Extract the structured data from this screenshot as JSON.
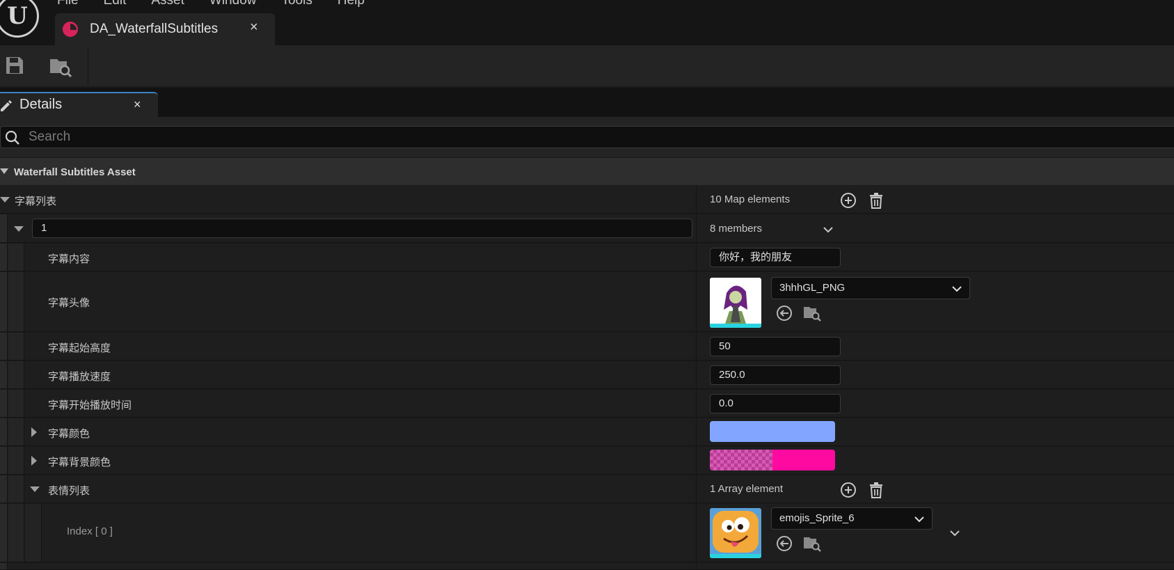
{
  "menu": [
    "File",
    "Edit",
    "Asset",
    "Window",
    "Tools",
    "Help"
  ],
  "document_tab": {
    "title": "DA_WaterfallSubtitles",
    "close": "×"
  },
  "details_tab": {
    "label": "Details",
    "close": "×"
  },
  "search": {
    "placeholder": "Search"
  },
  "category": {
    "label": "Waterfall Subtitles Asset"
  },
  "subtitle_list": {
    "label": "字幕列表",
    "count": "10 Map elements",
    "entry": {
      "key": "1",
      "members": "8 members",
      "content": {
        "label": "字幕内容",
        "value": "你好，我的朋友"
      },
      "avatar": {
        "label": "字幕头像",
        "asset": "3hhhGL_PNG"
      },
      "start_height": {
        "label": "字幕起始高度",
        "value": "50"
      },
      "play_speed": {
        "label": "字幕播放速度",
        "value": "250.0"
      },
      "start_time": {
        "label": "字幕开始播放时间",
        "value": "0.0"
      },
      "color": {
        "label": "字幕颜色",
        "hex": "#82a6ff"
      },
      "bg_color": {
        "label": "字幕背景颜色",
        "hex": "#ff0aa0"
      },
      "emoji_list": {
        "label": "表情列表",
        "count": "1 Array element",
        "index_label": "Index [ 0 ]",
        "asset": "emojis_Sprite_6"
      }
    }
  },
  "colors": {
    "accent": "#3b82c4",
    "tab_icon": "#d8245a"
  }
}
